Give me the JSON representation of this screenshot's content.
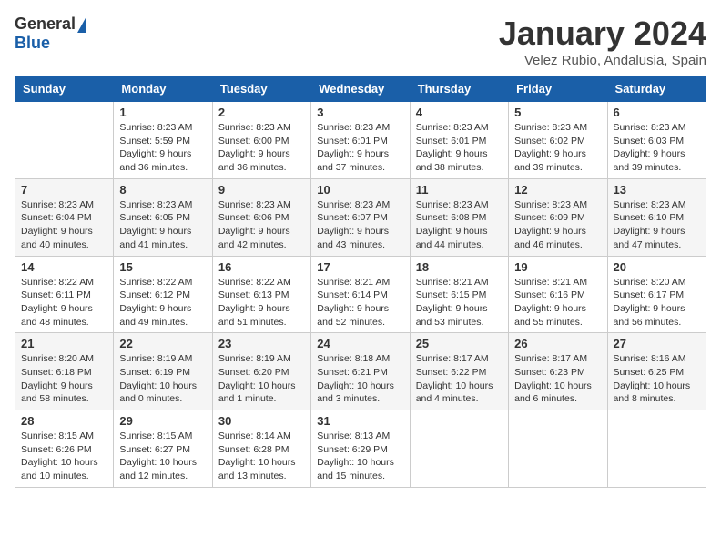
{
  "header": {
    "logo_general": "General",
    "logo_blue": "Blue",
    "month_title": "January 2024",
    "location": "Velez Rubio, Andalusia, Spain"
  },
  "weekdays": [
    "Sunday",
    "Monday",
    "Tuesday",
    "Wednesday",
    "Thursday",
    "Friday",
    "Saturday"
  ],
  "weeks": [
    [
      {
        "day": "",
        "info": ""
      },
      {
        "day": "1",
        "info": "Sunrise: 8:23 AM\nSunset: 5:59 PM\nDaylight: 9 hours\nand 36 minutes."
      },
      {
        "day": "2",
        "info": "Sunrise: 8:23 AM\nSunset: 6:00 PM\nDaylight: 9 hours\nand 36 minutes."
      },
      {
        "day": "3",
        "info": "Sunrise: 8:23 AM\nSunset: 6:01 PM\nDaylight: 9 hours\nand 37 minutes."
      },
      {
        "day": "4",
        "info": "Sunrise: 8:23 AM\nSunset: 6:01 PM\nDaylight: 9 hours\nand 38 minutes."
      },
      {
        "day": "5",
        "info": "Sunrise: 8:23 AM\nSunset: 6:02 PM\nDaylight: 9 hours\nand 39 minutes."
      },
      {
        "day": "6",
        "info": "Sunrise: 8:23 AM\nSunset: 6:03 PM\nDaylight: 9 hours\nand 39 minutes."
      }
    ],
    [
      {
        "day": "7",
        "info": "Sunrise: 8:23 AM\nSunset: 6:04 PM\nDaylight: 9 hours\nand 40 minutes."
      },
      {
        "day": "8",
        "info": "Sunrise: 8:23 AM\nSunset: 6:05 PM\nDaylight: 9 hours\nand 41 minutes."
      },
      {
        "day": "9",
        "info": "Sunrise: 8:23 AM\nSunset: 6:06 PM\nDaylight: 9 hours\nand 42 minutes."
      },
      {
        "day": "10",
        "info": "Sunrise: 8:23 AM\nSunset: 6:07 PM\nDaylight: 9 hours\nand 43 minutes."
      },
      {
        "day": "11",
        "info": "Sunrise: 8:23 AM\nSunset: 6:08 PM\nDaylight: 9 hours\nand 44 minutes."
      },
      {
        "day": "12",
        "info": "Sunrise: 8:23 AM\nSunset: 6:09 PM\nDaylight: 9 hours\nand 46 minutes."
      },
      {
        "day": "13",
        "info": "Sunrise: 8:23 AM\nSunset: 6:10 PM\nDaylight: 9 hours\nand 47 minutes."
      }
    ],
    [
      {
        "day": "14",
        "info": "Sunrise: 8:22 AM\nSunset: 6:11 PM\nDaylight: 9 hours\nand 48 minutes."
      },
      {
        "day": "15",
        "info": "Sunrise: 8:22 AM\nSunset: 6:12 PM\nDaylight: 9 hours\nand 49 minutes."
      },
      {
        "day": "16",
        "info": "Sunrise: 8:22 AM\nSunset: 6:13 PM\nDaylight: 9 hours\nand 51 minutes."
      },
      {
        "day": "17",
        "info": "Sunrise: 8:21 AM\nSunset: 6:14 PM\nDaylight: 9 hours\nand 52 minutes."
      },
      {
        "day": "18",
        "info": "Sunrise: 8:21 AM\nSunset: 6:15 PM\nDaylight: 9 hours\nand 53 minutes."
      },
      {
        "day": "19",
        "info": "Sunrise: 8:21 AM\nSunset: 6:16 PM\nDaylight: 9 hours\nand 55 minutes."
      },
      {
        "day": "20",
        "info": "Sunrise: 8:20 AM\nSunset: 6:17 PM\nDaylight: 9 hours\nand 56 minutes."
      }
    ],
    [
      {
        "day": "21",
        "info": "Sunrise: 8:20 AM\nSunset: 6:18 PM\nDaylight: 9 hours\nand 58 minutes."
      },
      {
        "day": "22",
        "info": "Sunrise: 8:19 AM\nSunset: 6:19 PM\nDaylight: 10 hours\nand 0 minutes."
      },
      {
        "day": "23",
        "info": "Sunrise: 8:19 AM\nSunset: 6:20 PM\nDaylight: 10 hours\nand 1 minute."
      },
      {
        "day": "24",
        "info": "Sunrise: 8:18 AM\nSunset: 6:21 PM\nDaylight: 10 hours\nand 3 minutes."
      },
      {
        "day": "25",
        "info": "Sunrise: 8:17 AM\nSunset: 6:22 PM\nDaylight: 10 hours\nand 4 minutes."
      },
      {
        "day": "26",
        "info": "Sunrise: 8:17 AM\nSunset: 6:23 PM\nDaylight: 10 hours\nand 6 minutes."
      },
      {
        "day": "27",
        "info": "Sunrise: 8:16 AM\nSunset: 6:25 PM\nDaylight: 10 hours\nand 8 minutes."
      }
    ],
    [
      {
        "day": "28",
        "info": "Sunrise: 8:15 AM\nSunset: 6:26 PM\nDaylight: 10 hours\nand 10 minutes."
      },
      {
        "day": "29",
        "info": "Sunrise: 8:15 AM\nSunset: 6:27 PM\nDaylight: 10 hours\nand 12 minutes."
      },
      {
        "day": "30",
        "info": "Sunrise: 8:14 AM\nSunset: 6:28 PM\nDaylight: 10 hours\nand 13 minutes."
      },
      {
        "day": "31",
        "info": "Sunrise: 8:13 AM\nSunset: 6:29 PM\nDaylight: 10 hours\nand 15 minutes."
      },
      {
        "day": "",
        "info": ""
      },
      {
        "day": "",
        "info": ""
      },
      {
        "day": "",
        "info": ""
      }
    ]
  ]
}
